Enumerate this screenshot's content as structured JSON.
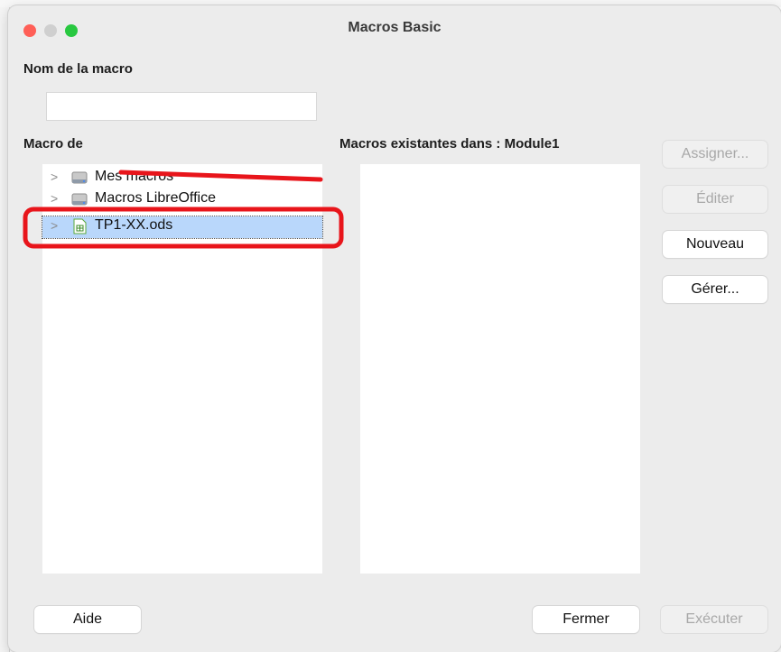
{
  "window": {
    "title": "Macros Basic"
  },
  "macro_name": {
    "label": "Nom de la macro",
    "value": ""
  },
  "macro_from": {
    "label": "Macro de",
    "items": [
      {
        "label": "Mes macros",
        "icon": "drive-icon"
      },
      {
        "label": "Macros LibreOffice",
        "icon": "drive-icon"
      },
      {
        "label": "TP1-XX.ods",
        "icon": "spreadsheet-icon",
        "selected": true
      }
    ]
  },
  "existing_macros": {
    "label": "Macros existantes dans : Module1",
    "items": []
  },
  "buttons": {
    "assign": "Assigner...",
    "edit": "Éditer",
    "new": "Nouveau",
    "manage": "Gérer...",
    "help": "Aide",
    "close": "Fermer",
    "run": "Exécuter"
  },
  "colors": {
    "selection": "#b9d7fb",
    "annotation_red": "#e8151b",
    "traffic_close": "#ff5f57",
    "traffic_max": "#28c840"
  }
}
